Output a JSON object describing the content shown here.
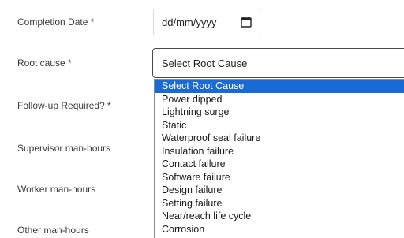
{
  "form": {
    "completion_date_label": "Completion Date *",
    "completion_date_placeholder": "dd/mm/yyyy",
    "root_cause_label": "Root cause *",
    "root_cause_selected": "Select Root Cause",
    "follow_up_label": "Follow-up Required? *",
    "supervisor_hours_label": "Supervisor man-hours",
    "worker_hours_label": "Worker man-hours",
    "other_hours_label": "Other man-hours"
  },
  "dropdown": {
    "options": [
      "Select Root Cause",
      "Power dipped",
      "Lightning surge",
      "Static",
      "Waterproof seal failure",
      "Insulation failure",
      "Contact failure",
      "Software failure",
      "Design failure",
      "Setting failure",
      "Near/reach life cycle",
      "Corrosion"
    ],
    "highlighted_index": 0
  },
  "colors": {
    "highlight": "#1a6ad6",
    "label_text": "#3b3b3b"
  },
  "icons": {
    "date_picker": "calendar-icon"
  }
}
